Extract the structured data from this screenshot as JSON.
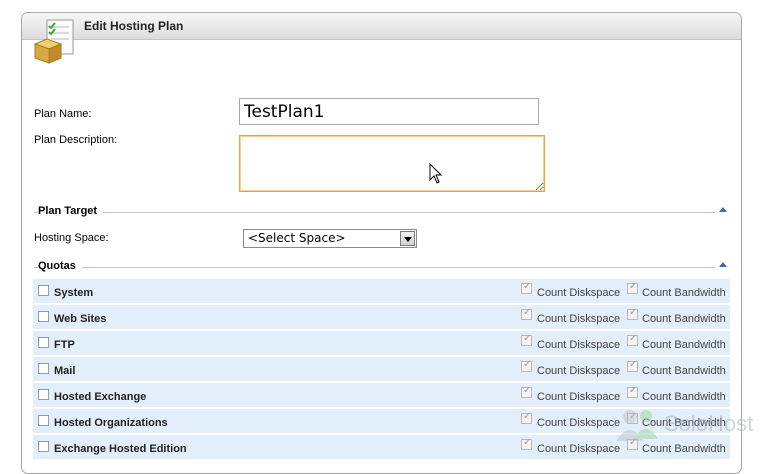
{
  "panel": {
    "title": "Edit Hosting Plan"
  },
  "form": {
    "plan_name_label": "Plan Name:",
    "plan_name_value": "TestPlan1",
    "plan_description_label": "Plan Description:",
    "plan_description_value": ""
  },
  "plan_target": {
    "title": "Plan Target",
    "hosting_space_label": "Hosting Space:",
    "hosting_space_value": "<Select Space>"
  },
  "quotas": {
    "title": "Quotas",
    "count_diskspace_label": "Count Diskspace",
    "count_bandwidth_label": "Count Bandwidth",
    "rows": [
      {
        "label": "System",
        "checked": false,
        "count_diskspace": true,
        "count_bandwidth": true
      },
      {
        "label": "Web Sites",
        "checked": false,
        "count_diskspace": true,
        "count_bandwidth": true
      },
      {
        "label": "FTP",
        "checked": false,
        "count_diskspace": true,
        "count_bandwidth": true
      },
      {
        "label": "Mail",
        "checked": false,
        "count_diskspace": true,
        "count_bandwidth": true
      },
      {
        "label": "Hosted Exchange",
        "checked": false,
        "count_diskspace": true,
        "count_bandwidth": true
      },
      {
        "label": "Hosted Organizations",
        "checked": false,
        "count_diskspace": true,
        "count_bandwidth": true
      },
      {
        "label": "Exchange Hosted Edition",
        "checked": false,
        "count_diskspace": true,
        "count_bandwidth": true
      }
    ]
  },
  "watermark": {
    "text": "SoloHost"
  },
  "colors": {
    "row_background": "#e3eefb",
    "focus_border": "#e8a33a",
    "section_line": "#b9c7d9",
    "accent": "#3d6bb3"
  }
}
